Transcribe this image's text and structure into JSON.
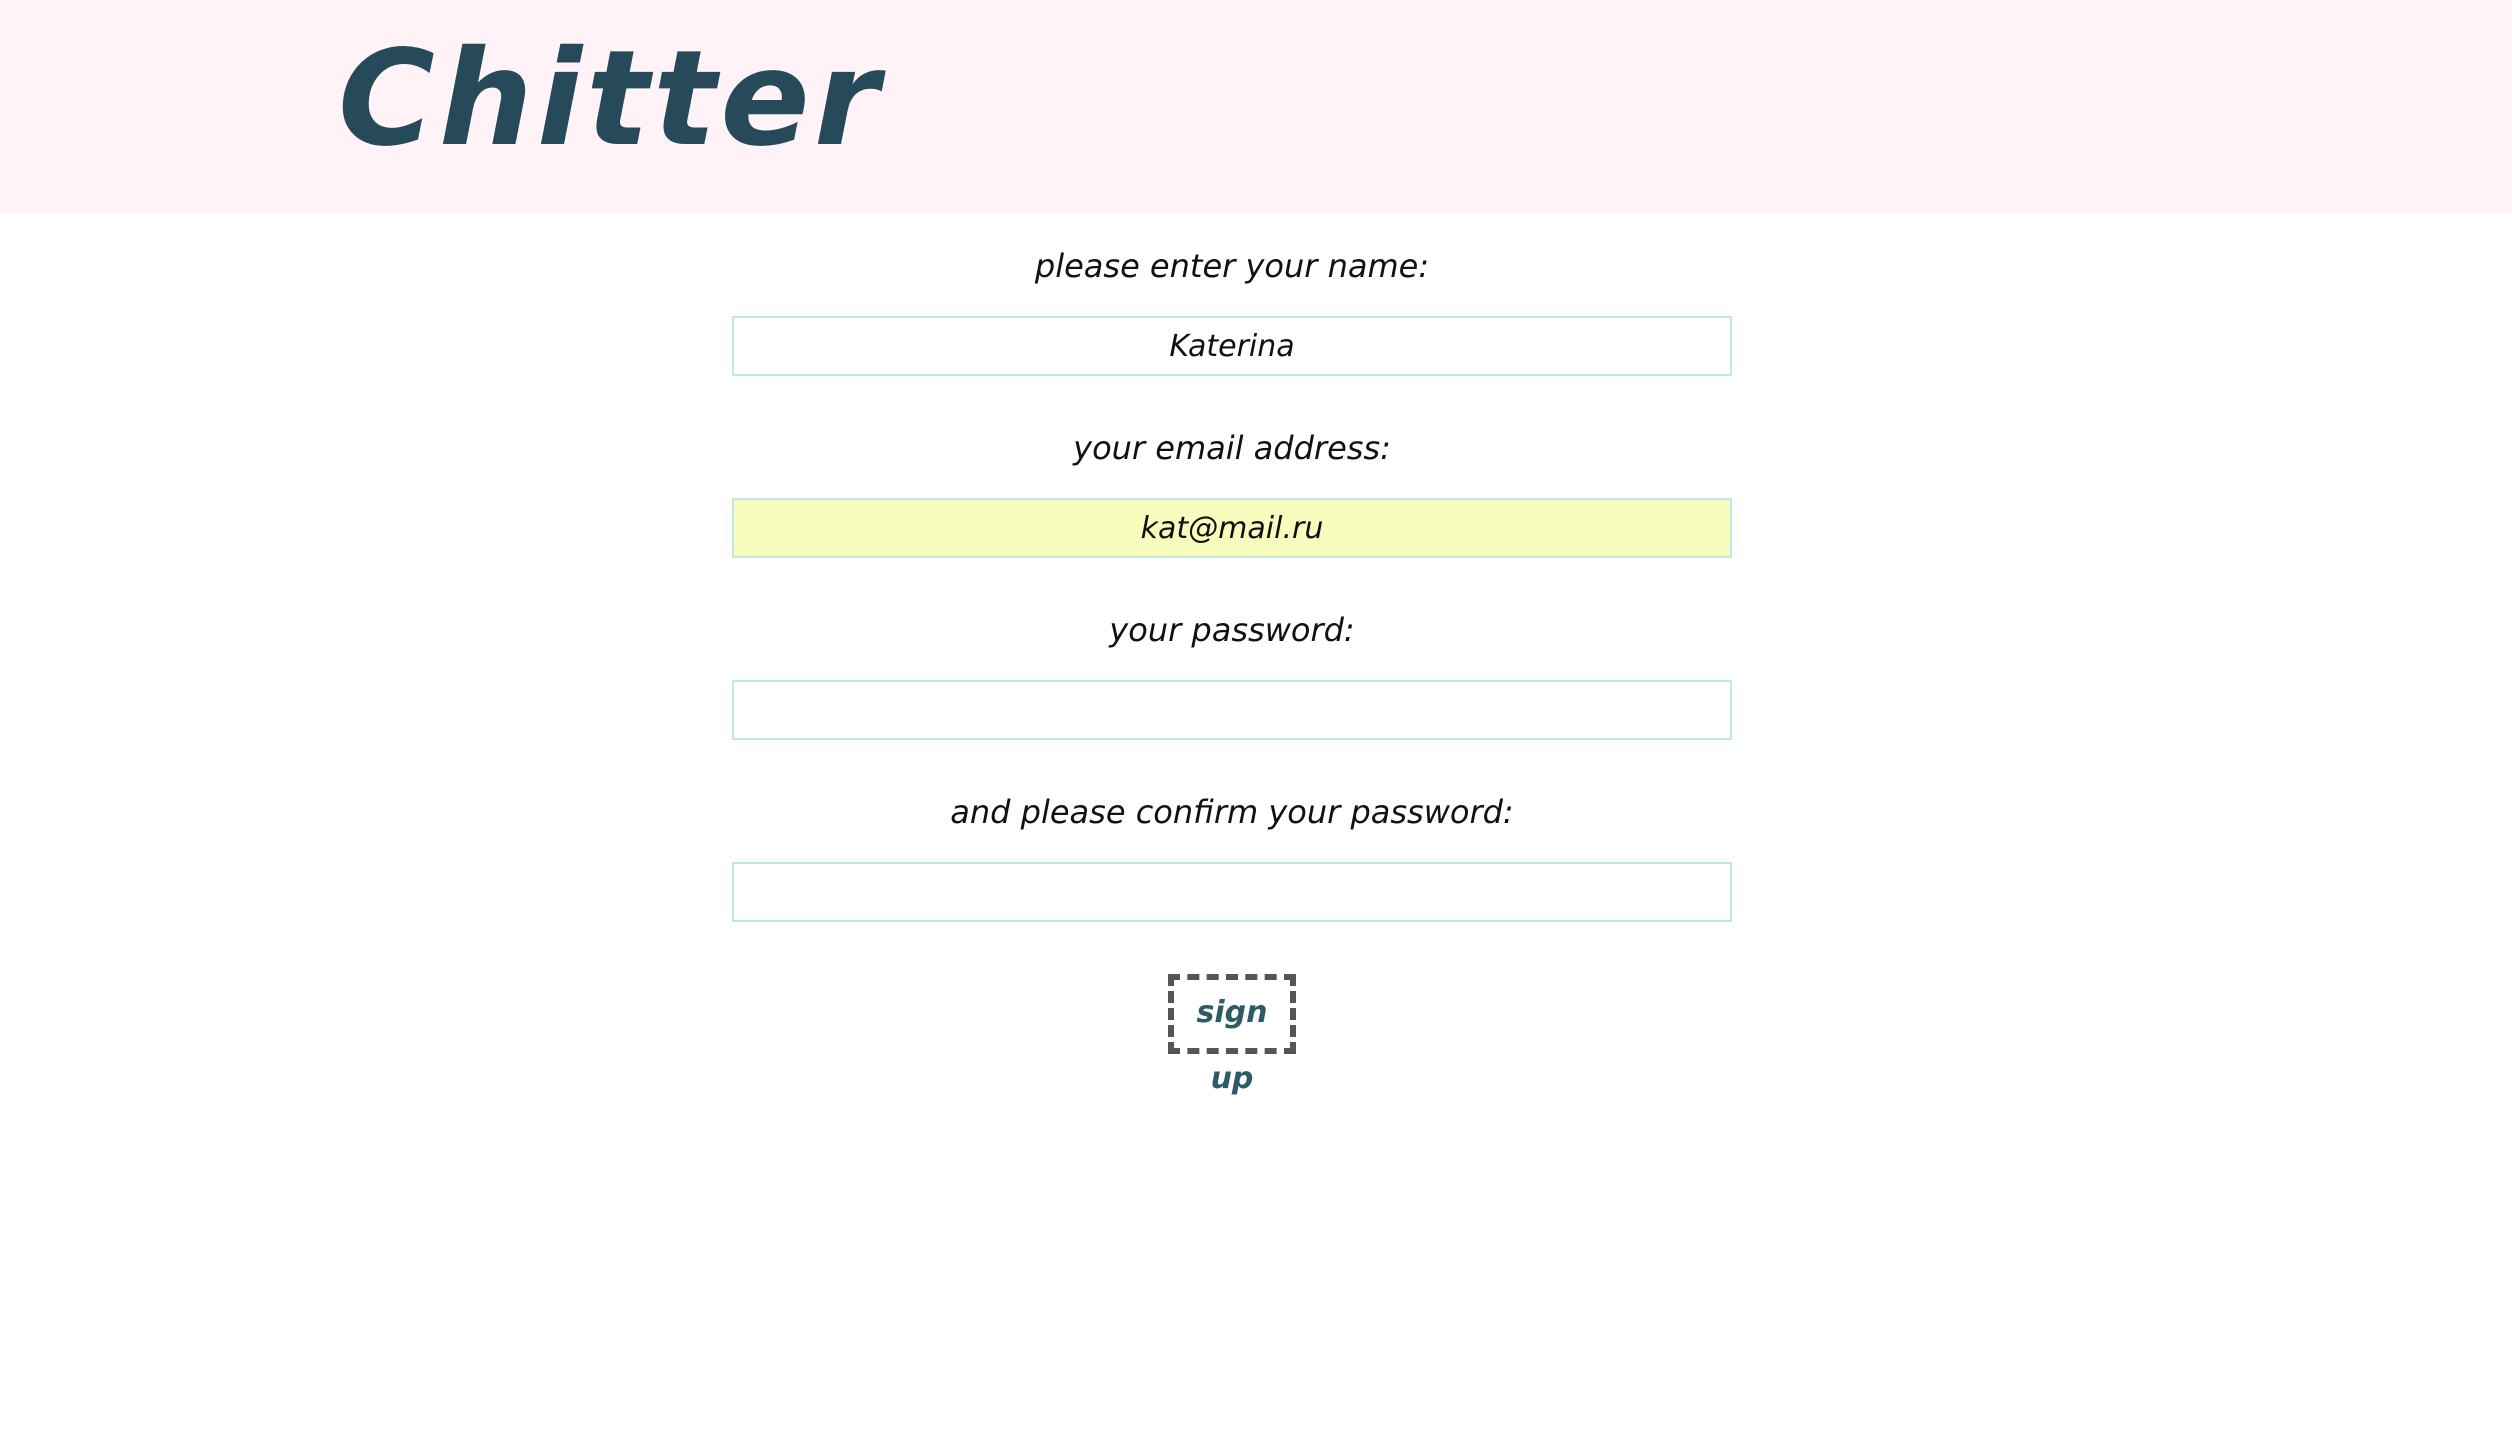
{
  "header": {
    "logo": "Chitter",
    "background": "#fff3f7",
    "logo_color": "#264a59"
  },
  "form": {
    "name_label": "please enter your name:",
    "name_value": "Katerina",
    "email_label": "your email address:",
    "email_value": "kat@mail.ru",
    "password_label": "your password:",
    "password_value": "",
    "confirm_label": "and please confirm your password:",
    "confirm_value": "",
    "submit_label": "sign up",
    "field_border_color": "#bfe7e4",
    "autofill_color": "#f8fdbd"
  }
}
